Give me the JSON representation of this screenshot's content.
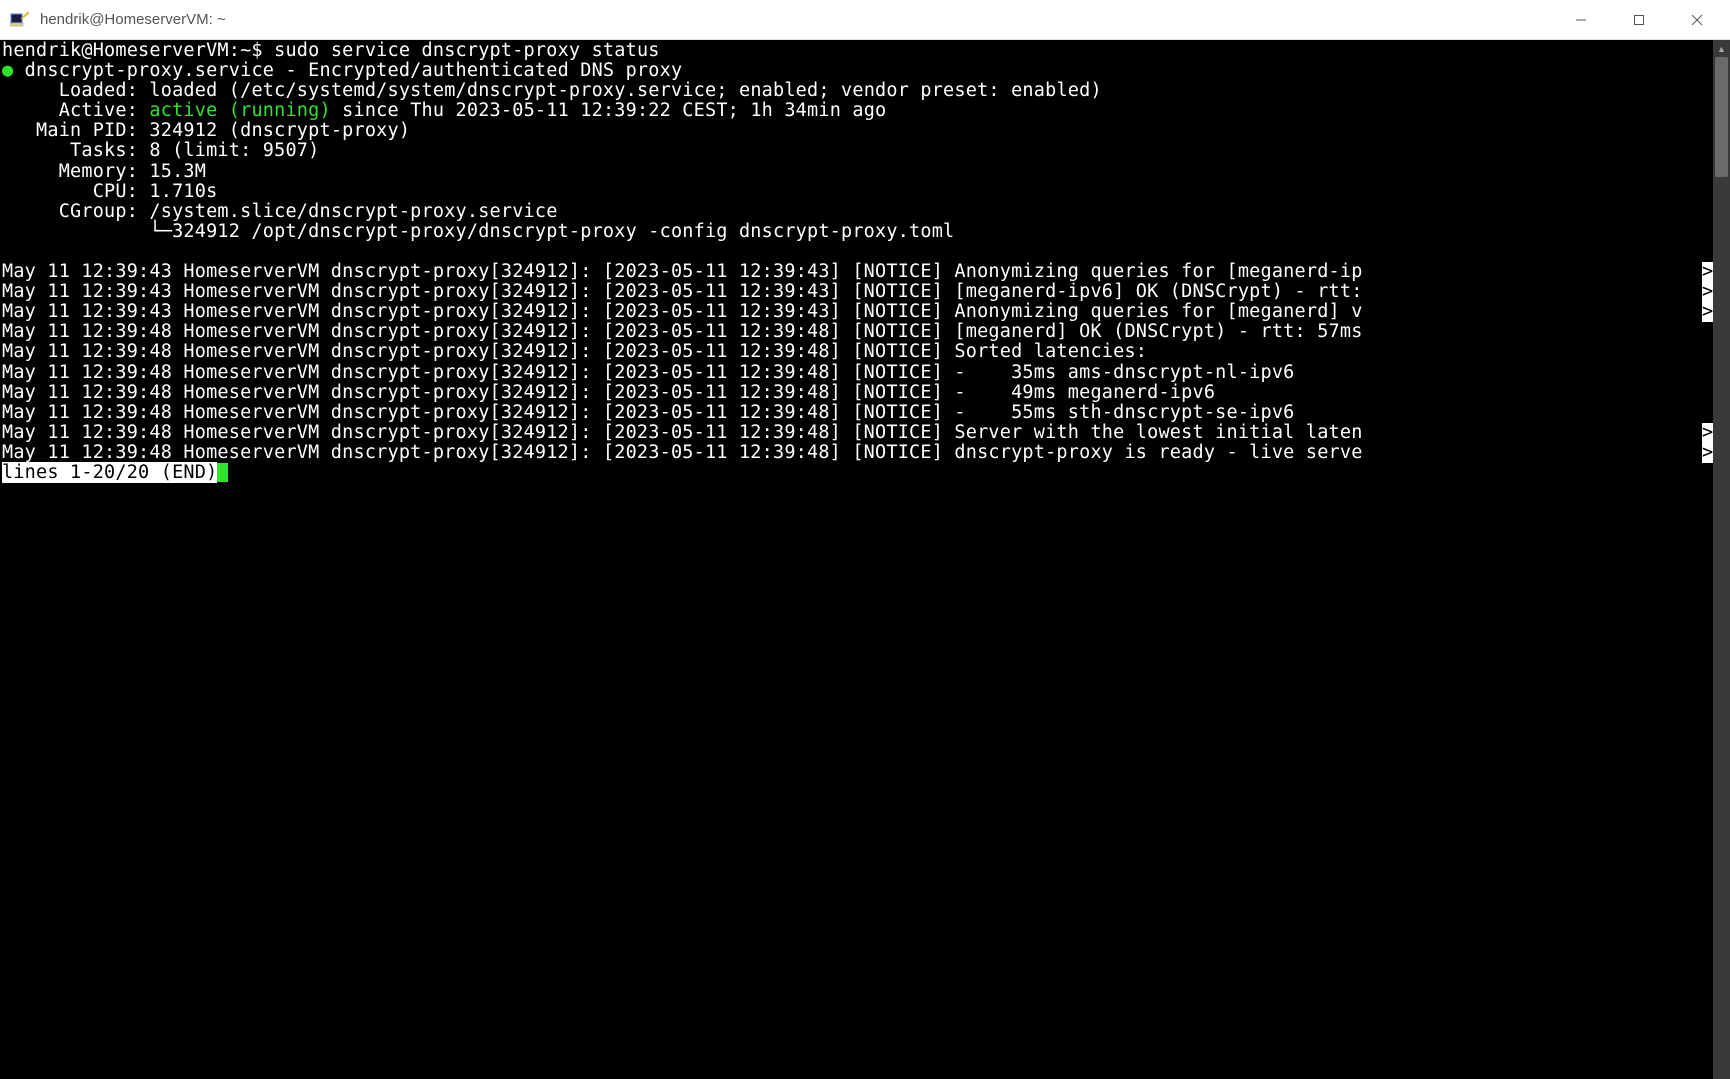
{
  "window": {
    "title": "hendrik@HomeserverVM: ~"
  },
  "prompt": {
    "user_host_path": "hendrik@HomeserverVM:~$ ",
    "command": "sudo service dnscrypt-proxy status"
  },
  "status": {
    "bullet": "●",
    "header": " dnscrypt-proxy.service - Encrypted/authenticated DNS proxy",
    "loaded_label": "     Loaded: ",
    "loaded_value": "loaded (/etc/systemd/system/dnscrypt-proxy.service; enabled; vendor preset: enabled)",
    "active_label": "     Active: ",
    "active_state": "active (running)",
    "active_rest": " since Thu 2023-05-11 12:39:22 CEST; 1h 34min ago",
    "mainpid_label": "   Main PID: ",
    "mainpid_value": "324912 (dnscrypt-proxy)",
    "tasks_label": "      Tasks: ",
    "tasks_value": "8 (limit: 9507)",
    "memory_label": "     Memory: ",
    "memory_value": "15.3M",
    "cpu_label": "        CPU: ",
    "cpu_value": "1.710s",
    "cgroup_label": "     CGroup: ",
    "cgroup_value": "/system.slice/dnscrypt-proxy.service",
    "cgroup_child": "             └─324912 /opt/dnscrypt-proxy/dnscrypt-proxy -config dnscrypt-proxy.toml"
  },
  "logs": [
    {
      "text": "May 11 12:39:43 HomeserverVM dnscrypt-proxy[324912]: [2023-05-11 12:39:43] [NOTICE] Anonymizing queries for [meganerd-ip",
      "trunc": true
    },
    {
      "text": "May 11 12:39:43 HomeserverVM dnscrypt-proxy[324912]: [2023-05-11 12:39:43] [NOTICE] [meganerd-ipv6] OK (DNSCrypt) - rtt:",
      "trunc": true
    },
    {
      "text": "May 11 12:39:43 HomeserverVM dnscrypt-proxy[324912]: [2023-05-11 12:39:43] [NOTICE] Anonymizing queries for [meganerd] v",
      "trunc": true
    },
    {
      "text": "May 11 12:39:48 HomeserverVM dnscrypt-proxy[324912]: [2023-05-11 12:39:48] [NOTICE] [meganerd] OK (DNSCrypt) - rtt: 57ms",
      "trunc": false
    },
    {
      "text": "May 11 12:39:48 HomeserverVM dnscrypt-proxy[324912]: [2023-05-11 12:39:48] [NOTICE] Sorted latencies:",
      "trunc": false
    },
    {
      "text": "May 11 12:39:48 HomeserverVM dnscrypt-proxy[324912]: [2023-05-11 12:39:48] [NOTICE] -    35ms ams-dnscrypt-nl-ipv6",
      "trunc": false
    },
    {
      "text": "May 11 12:39:48 HomeserverVM dnscrypt-proxy[324912]: [2023-05-11 12:39:48] [NOTICE] -    49ms meganerd-ipv6",
      "trunc": false
    },
    {
      "text": "May 11 12:39:48 HomeserverVM dnscrypt-proxy[324912]: [2023-05-11 12:39:48] [NOTICE] -    55ms sth-dnscrypt-se-ipv6",
      "trunc": false
    },
    {
      "text": "May 11 12:39:48 HomeserverVM dnscrypt-proxy[324912]: [2023-05-11 12:39:48] [NOTICE] Server with the lowest initial laten",
      "trunc": true
    },
    {
      "text": "May 11 12:39:48 HomeserverVM dnscrypt-proxy[324912]: [2023-05-11 12:39:48] [NOTICE] dnscrypt-proxy is ready - live serve",
      "trunc": true
    }
  ],
  "pager": {
    "status": "lines 1-20/20 (END)",
    "trunc_char": ">"
  }
}
